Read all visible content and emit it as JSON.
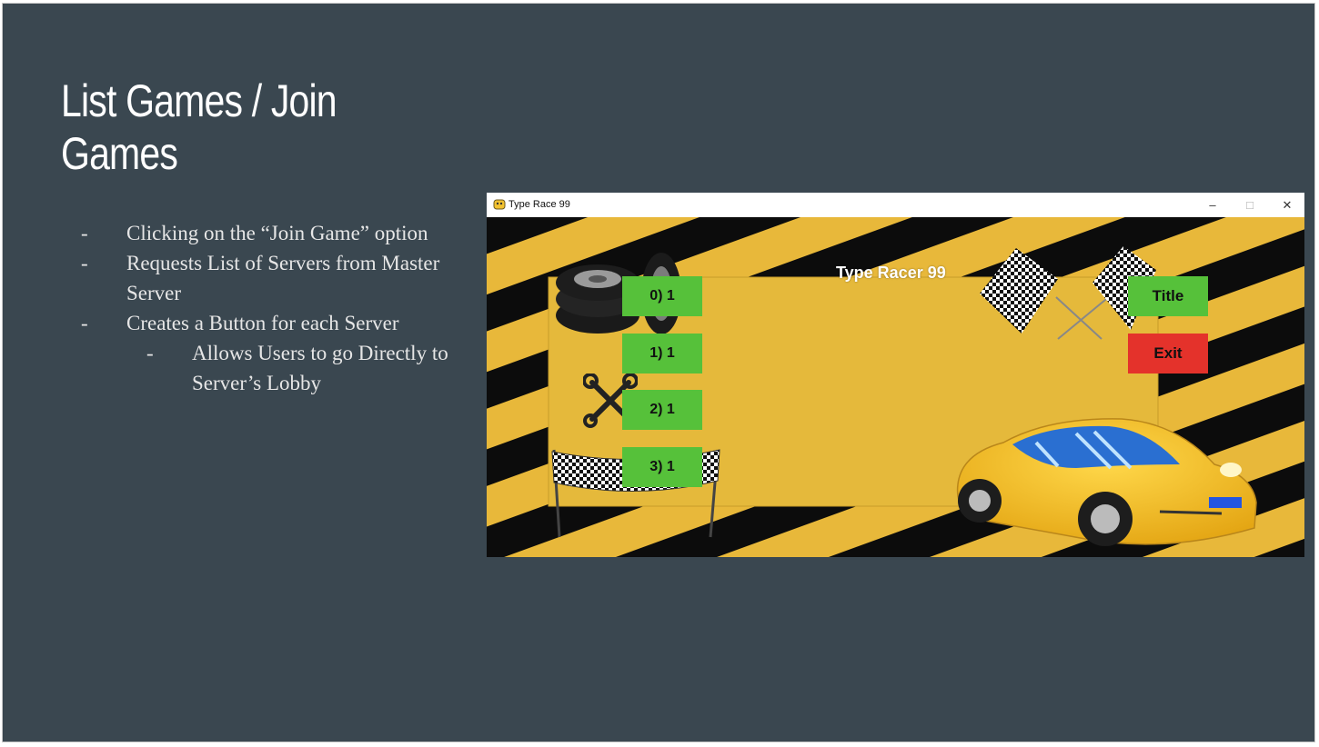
{
  "slide": {
    "title": "List Games / Join Games",
    "bullets": [
      {
        "dash": "-",
        "text": "Clicking on the “Join Game” option"
      },
      {
        "dash": "-",
        "text": "Requests List of Servers from Master Server"
      },
      {
        "dash": "-",
        "text": "Creates a Button for each Server"
      },
      {
        "dash": "-",
        "text": "Allows Users to go Directly to Server’s Lobby",
        "level": 2
      }
    ]
  },
  "window": {
    "title": "Type Race 99",
    "controls": {
      "minimize": "–",
      "maximize": "□",
      "close": "✕"
    }
  },
  "game": {
    "heading": "Type Racer 99",
    "servers": [
      "0) 1",
      "1) 1",
      "2) 1",
      "3) 1"
    ],
    "title_button": "Title",
    "exit_button": "Exit"
  },
  "colors": {
    "slide_bg": "#3a4750",
    "stripe_yellow": "#e8b83a",
    "server_button": "#56c13a",
    "title_button": "#56c13a",
    "exit_button": "#e4322b"
  },
  "icons": [
    "tire-stack-icon",
    "wrench-icon",
    "checkered-flags-icon",
    "race-banner-icon",
    "sports-car-icon",
    "pygame-icon"
  ]
}
